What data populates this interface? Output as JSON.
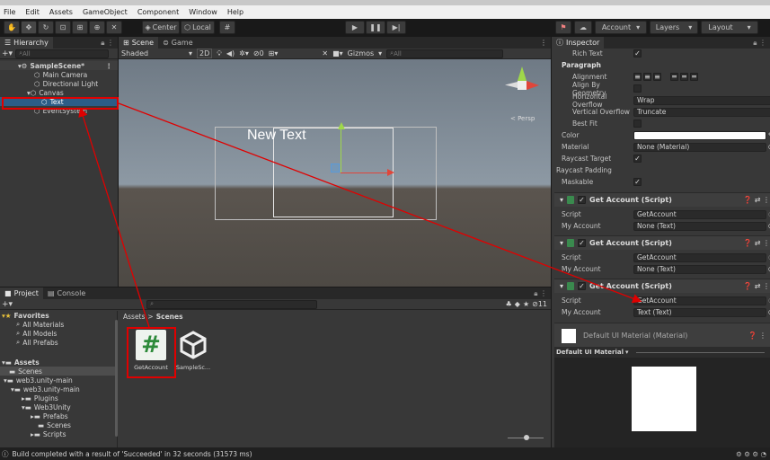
{
  "menu": [
    "File",
    "Edit",
    "Assets",
    "GameObject",
    "Component",
    "Window",
    "Help"
  ],
  "toolbar": {
    "center_label": "Center",
    "local_label": "Local",
    "account_label": "Account",
    "layers_label": "Layers",
    "layout_label": "Layout"
  },
  "hierarchy": {
    "tab": "Hierarchy",
    "search_placeholder": "All",
    "items": [
      {
        "label": "SampleScene*"
      },
      {
        "label": "Main Camera"
      },
      {
        "label": "Directional Light"
      },
      {
        "label": "Canvas"
      },
      {
        "label": "Text"
      },
      {
        "label": "EventSystem"
      }
    ]
  },
  "scene": {
    "tab_scene": "Scene",
    "tab_game": "Game",
    "shading": "Shaded",
    "mode_2d": "2D",
    "gizmos": "Gizmos",
    "layers_count": "0",
    "search_placeholder": "All",
    "persp_label": "< Persp",
    "canvas_text": "New Text"
  },
  "project": {
    "tab_project": "Project",
    "tab_console": "Console",
    "breadcrumb_root": "Assets",
    "breadcrumb_sep": ">",
    "breadcrumb_current": "Scenes",
    "hidden_count": "11",
    "tree": [
      {
        "label": "Favorites"
      },
      {
        "label": "All Materials"
      },
      {
        "label": "All Models"
      },
      {
        "label": "All Prefabs"
      },
      {
        "label": "Assets"
      },
      {
        "label": "Scenes"
      },
      {
        "label": "web3.unity-main"
      },
      {
        "label": "web3.unity-main"
      },
      {
        "label": "Plugins"
      },
      {
        "label": "Web3Unity"
      },
      {
        "label": "Prefabs"
      },
      {
        "label": "Scenes"
      },
      {
        "label": "Scripts"
      }
    ],
    "assets": [
      {
        "label": "GetAccount",
        "glyph": "#"
      },
      {
        "label": "SampleSc..."
      }
    ]
  },
  "inspector": {
    "tab": "Inspector",
    "rich_text_label": "Rich Text",
    "paragraph_label": "Paragraph",
    "fields": [
      {
        "label": "Alignment",
        "value": ""
      },
      {
        "label": "Align By Geometry",
        "value": ""
      },
      {
        "label": "Horizontal Overflow",
        "value": "Wrap"
      },
      {
        "label": "Vertical Overflow",
        "value": "Truncate"
      },
      {
        "label": "Best Fit",
        "value": ""
      },
      {
        "label": "Color",
        "value": ""
      },
      {
        "label": "Material",
        "value": "None (Material)"
      },
      {
        "label": "Raycast Target",
        "value": ""
      },
      {
        "label": "Raycast Padding",
        "value": ""
      },
      {
        "label": "Maskable",
        "value": ""
      }
    ],
    "components": [
      {
        "title": "Get Account (Script)",
        "script_label": "Script",
        "script_value": "GetAccount",
        "field_label": "My Account",
        "field_value": "None (Text)"
      },
      {
        "title": "Get Account (Script)",
        "script_label": "Script",
        "script_value": "GetAccount",
        "field_label": "My Account",
        "field_value": "None (Text)"
      },
      {
        "title": "Get Account (Script)",
        "script_label": "Script",
        "script_value": "GetAccount",
        "field_label": "My Account",
        "field_value": "Text (Text)"
      }
    ],
    "material_title": "Default UI Material (Material)",
    "material_preview_label": "Default UI Material"
  },
  "status": {
    "message": "Build completed with a result of 'Succeeded' in 32 seconds (31573 ms)"
  },
  "colors": {
    "annotation": "#e00000",
    "selection": "#2c5d87",
    "accent_green": "#3a8a4e"
  }
}
